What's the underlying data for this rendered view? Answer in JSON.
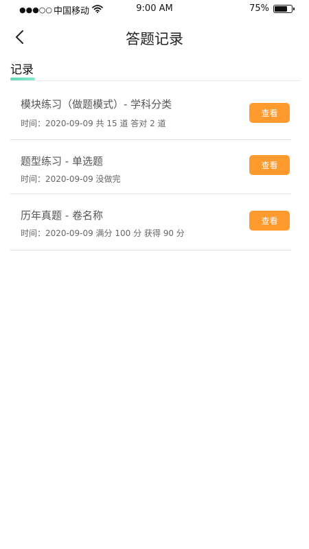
{
  "status_bar": {
    "signal": "●●●○○",
    "carrier": "中国移动",
    "wifi_icon": "wifi-icon",
    "time": "9:00 AM",
    "battery_percent": "75%",
    "battery_level": 0.75
  },
  "nav": {
    "back_icon": "chevron-left-icon",
    "title": "答题记录"
  },
  "tabs": [
    {
      "label": "记录",
      "active": true
    }
  ],
  "colors": {
    "accent_button": "#ff9a2e",
    "tab_indicator": "#5cd6b4",
    "divider": "#e6e6e6"
  },
  "records": [
    {
      "title": "模块练习（做题模式）- 学科分类",
      "meta": "时间：2020-09-09 共 15 道 答对 2 道",
      "button": "查看"
    },
    {
      "title": "题型练习 - 单选题",
      "meta": "时间：2020-09-09   没做完",
      "button": "查看"
    },
    {
      "title": "历年真题 - 卷名称",
      "meta": "时间：2020-09-09 满分 100 分 获得 90 分",
      "button": "查看"
    }
  ]
}
